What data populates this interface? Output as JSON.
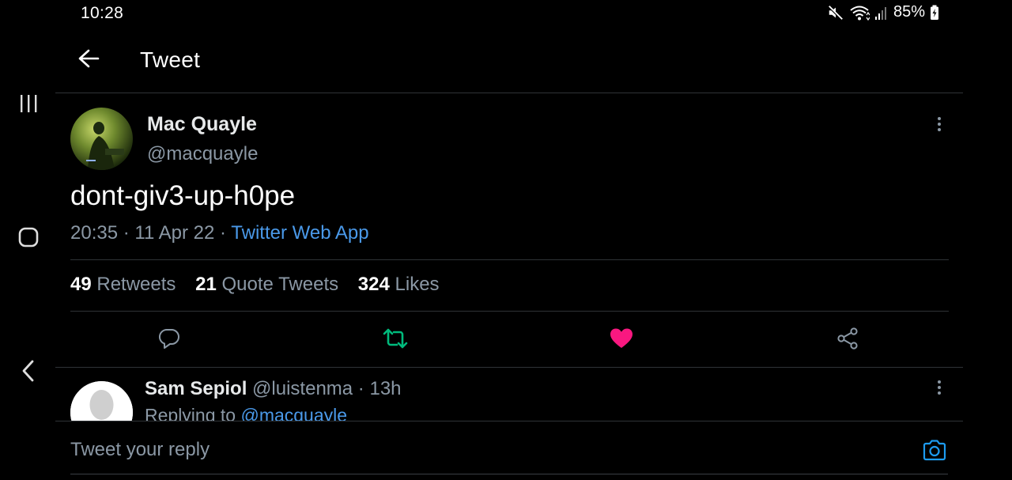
{
  "status_bar": {
    "time": "10:28",
    "battery": "85%",
    "icons": [
      "mute-icon",
      "wifi-icon",
      "signal-icon",
      "battery-charging-icon"
    ]
  },
  "nav": {
    "icons": [
      "recent-apps-icon",
      "home-icon",
      "back-nav-icon"
    ]
  },
  "header": {
    "title": "Tweet",
    "back_icon": "arrow-left-icon"
  },
  "tweet": {
    "author_name": "Mac Quayle",
    "author_handle": "@macquayle",
    "text": "dont-giv3-up-h0pe",
    "time": "20:35",
    "date": "11 Apr 22",
    "source": "Twitter Web App",
    "separator": "·",
    "stats": [
      {
        "count": "49",
        "label": "Retweets"
      },
      {
        "count": "21",
        "label": "Quote Tweets"
      },
      {
        "count": "324",
        "label": "Likes"
      }
    ],
    "actions": [
      "reply-icon",
      "retweet-icon",
      "like-icon",
      "share-icon"
    ],
    "colors": {
      "retweet": "#00ba7c",
      "like": "#f91880",
      "link": "#4a99e9"
    }
  },
  "reply": {
    "author_name": "Sam Sepiol",
    "author_handle": "@luistenma",
    "time": "13h",
    "replying_prefix": "Replying to",
    "replying_to": "@macquayle"
  },
  "compose": {
    "placeholder": "Tweet your reply",
    "camera_icon": "camera-icon"
  }
}
